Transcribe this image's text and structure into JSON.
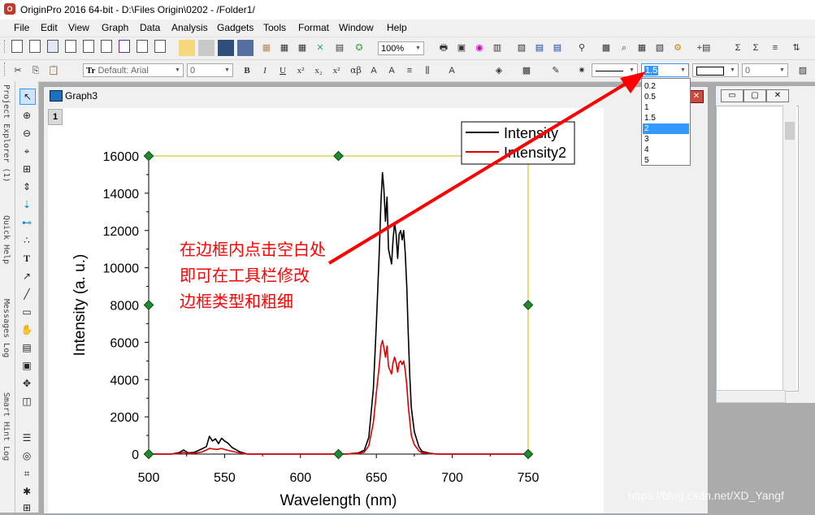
{
  "window": {
    "title": "OriginPro 2016 64-bit - D:\\Files Origin\\0202 - /Folder1/"
  },
  "menu": [
    "File",
    "Edit",
    "View",
    "Graph",
    "Data",
    "Analysis",
    "Gadgets",
    "Tools",
    "Format",
    "Window",
    "Help"
  ],
  "toolbar": {
    "zoom_value": "100%",
    "font_value": "Default: Arial",
    "font_size_value": "0",
    "thickness_value": "1.5",
    "line_style_value": "",
    "color_value": "0"
  },
  "left_panel_tabs": [
    "Project Explorer (1)",
    "Quick Help",
    "Messages Log",
    "Smart Hint Log"
  ],
  "graph_window": {
    "title": "Graph3",
    "layer_label": "1"
  },
  "thickness_options": [
    "0.2",
    "0.5",
    "1",
    "1.5",
    "2",
    "3",
    "4",
    "5"
  ],
  "thickness_selected": "2",
  "chart_data": {
    "type": "line",
    "xlabel": "Wavelength (nm)",
    "ylabel": "Intensity (a. u.)",
    "xlim": [
      500,
      750
    ],
    "ylim": [
      0,
      16000
    ],
    "xticks": [
      "500",
      "550",
      "600",
      "650",
      "700",
      "750"
    ],
    "yticks": [
      "0",
      "2000",
      "4000",
      "6000",
      "8000",
      "10000",
      "12000",
      "14000",
      "16000"
    ],
    "grid": false,
    "legend_position": "top-right",
    "series": [
      {
        "name": "Intensity",
        "color": "#000000",
        "x": [
          500,
          515,
          520,
          523,
          526,
          530,
          535,
          538,
          540,
          542,
          544,
          546,
          548,
          550,
          552,
          555,
          560,
          565,
          600,
          630,
          638,
          642,
          645,
          648,
          650,
          652,
          653,
          654,
          655,
          656,
          657,
          658,
          659,
          660,
          661,
          662,
          663,
          664,
          665,
          666,
          667,
          668,
          669,
          670,
          671,
          672,
          673,
          675,
          678,
          680,
          685,
          690,
          700,
          750
        ],
        "y": [
          0,
          0,
          80,
          220,
          60,
          90,
          280,
          400,
          950,
          700,
          820,
          560,
          850,
          700,
          600,
          350,
          120,
          0,
          0,
          0,
          60,
          200,
          900,
          3500,
          7000,
          11000,
          13500,
          15100,
          14200,
          12500,
          13800,
          11000,
          10600,
          10200,
          11500,
          12400,
          11800,
          10500,
          11800,
          12000,
          11500,
          12000,
          10800,
          9000,
          6500,
          4200,
          2500,
          1200,
          400,
          150,
          50,
          0,
          0,
          0
        ]
      },
      {
        "name": "Intensity2",
        "color": "#e00000",
        "x": [
          500,
          515,
          520,
          523,
          526,
          530,
          535,
          540,
          542,
          545,
          548,
          550,
          552,
          555,
          560,
          565,
          600,
          630,
          638,
          642,
          645,
          648,
          650,
          652,
          653,
          654,
          655,
          656,
          657,
          658,
          659,
          660,
          661,
          662,
          663,
          664,
          665,
          666,
          667,
          668,
          669,
          670,
          671,
          672,
          673,
          675,
          678,
          680,
          685,
          690,
          700,
          750
        ],
        "y": [
          0,
          0,
          30,
          90,
          20,
          40,
          110,
          300,
          280,
          250,
          300,
          250,
          200,
          150,
          60,
          0,
          0,
          0,
          30,
          100,
          450,
          1700,
          3300,
          4800,
          5800,
          6100,
          5700,
          5200,
          5800,
          4700,
          4500,
          4300,
          4900,
          5200,
          4900,
          4400,
          4900,
          5000,
          4800,
          5000,
          4500,
          3700,
          2600,
          1800,
          1000,
          500,
          180,
          70,
          20,
          0,
          0,
          0
        ]
      }
    ]
  },
  "annotation": {
    "lines": [
      "在边框内点击空白处",
      "即可在工具栏修改",
      "边框类型和粗细"
    ],
    "color": "#ff0000"
  },
  "watermark": "https://blog.csdn.net/XD_Yangf"
}
